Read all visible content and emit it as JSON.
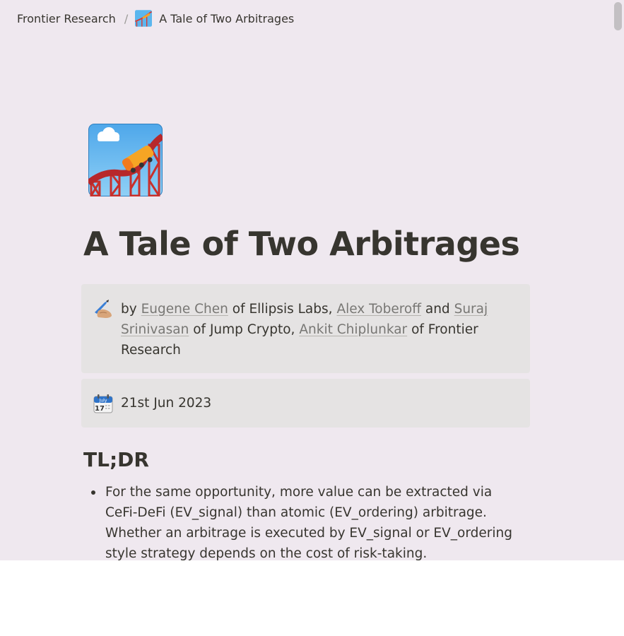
{
  "breadcrumb": {
    "parent": "Frontier Research",
    "separator": "/",
    "current": "A Tale of Two Arbitrages"
  },
  "page": {
    "title": "A Tale of Two Arbitrages",
    "icon": "roller-coaster-icon"
  },
  "authors_callout": {
    "icon": "writing-hand-icon",
    "by": "by",
    "author1": "Eugene Chen",
    "org1": "of Ellipsis Labs,",
    "author2": "Alex Toberoff",
    "and": "and",
    "author3": "Suraj Srinivasan",
    "org2": "of Jump Crypto,",
    "author4": "Ankit Chiplunkar",
    "org3": "of Frontier Research"
  },
  "date_callout": {
    "icon": "calendar-icon",
    "calendar_month": "July",
    "calendar_day": "17",
    "date": "21st Jun 2023"
  },
  "tldr": {
    "heading": "TL;DR",
    "bullets": [
      "For the same opportunity, more value can be extracted via CeFi-DeFi (EV_signal) than atomic (EV_ordering) arbitrage. Whether an arbitrage is executed by EV_signal or EV_ordering style strategy depends on the cost of risk-taking."
    ]
  },
  "colors": {
    "page_background": "#efe8ef",
    "callout_background": "#e5e3e3",
    "text": "#37352f",
    "link": "#787774"
  }
}
